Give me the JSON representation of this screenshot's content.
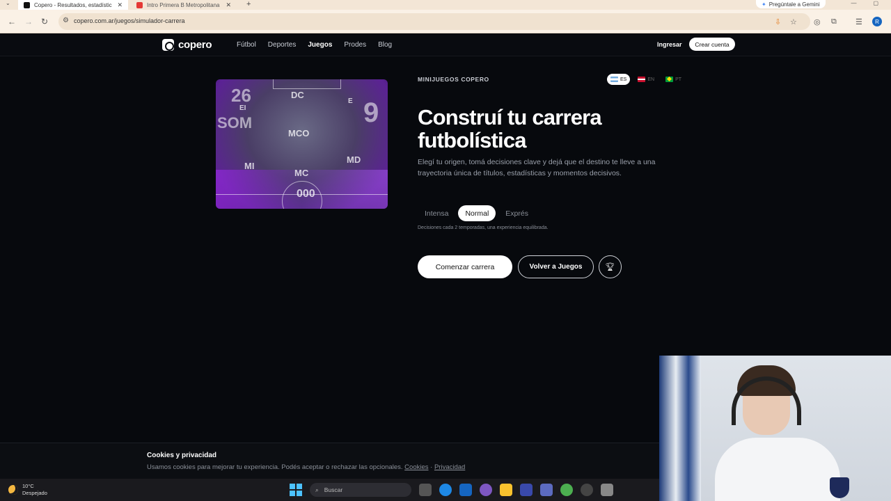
{
  "browser": {
    "tabs": [
      {
        "title": "Copero - Resultados, estadístic",
        "active": true
      },
      {
        "title": "Intro Primera B Metropolitana",
        "active": false
      }
    ],
    "gemini_label": "Pregúntale a Gemini",
    "url": "copero.com.ar/juegos/simulador-carrera",
    "profile_initial": "R"
  },
  "site": {
    "logo_text": "copero",
    "nav": [
      {
        "label": "Fútbol",
        "active": false
      },
      {
        "label": "Deportes",
        "active": false
      },
      {
        "label": "Juegos",
        "active": true
      },
      {
        "label": "Prodes",
        "active": false
      },
      {
        "label": "Blog",
        "active": false
      }
    ],
    "login_label": "Ingresar",
    "signup_label": "Crear cuenta"
  },
  "hero": {
    "image": {
      "positions": [
        "DC",
        "MCO",
        "MI",
        "MC",
        "MD",
        "EI",
        "E"
      ],
      "numbers": [
        "26",
        "9",
        "000"
      ],
      "side_text": "SOM"
    },
    "kicker": "MINIJUEGOS COPERO",
    "languages": [
      {
        "code": "ES",
        "active": true
      },
      {
        "code": "EN",
        "active": false
      },
      {
        "code": "PT",
        "active": false
      }
    ],
    "title": "Construí tu carrera futbolística",
    "description": "Elegí tu origen, tomá decisiones clave y dejá que el destino te lleve a una trayectoria única de títulos, estadísticas y momentos decisivos.",
    "modes": [
      {
        "label": "Intensa",
        "active": false
      },
      {
        "label": "Normal",
        "active": true
      },
      {
        "label": "Exprés",
        "active": false
      }
    ],
    "mode_description": "Decisiones cada 2 temporadas, una experiencia equilibrada.",
    "primary_button": "Comenzar carrera",
    "secondary_button": "Volver a Juegos"
  },
  "cookies": {
    "title": "Cookies y privacidad",
    "text": "Usamos cookies para mejorar tu experiencia. Podés aceptar o rechazar las opcionales.",
    "link_cookies": "Cookies",
    "separator": "·",
    "link_privacy": "Privacidad"
  },
  "taskbar": {
    "temperature": "10°C",
    "condition": "Despejado",
    "search_placeholder": "Buscar"
  }
}
